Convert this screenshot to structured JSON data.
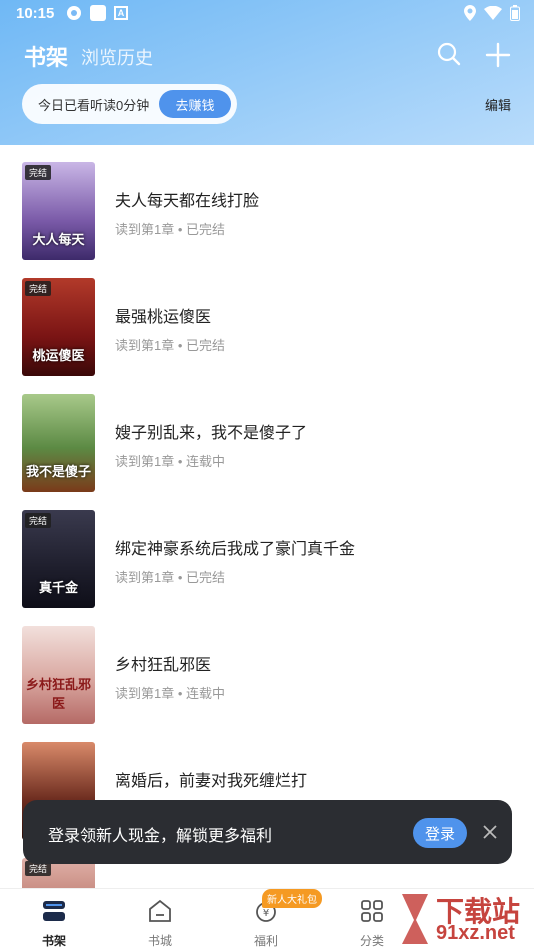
{
  "status_bar": {
    "time": "10:15"
  },
  "header": {
    "tab_active": "书架",
    "tab_inactive": "浏览历史",
    "reading_text": "今日已看听读0分钟",
    "earn_label": "去赚钱",
    "edit_label": "编辑"
  },
  "books": [
    {
      "title": "夫人每天都在线打脸",
      "status": "读到第1章 • 已完结",
      "badge": "完结",
      "cover_text": "大人每天",
      "cover_color": "#8a6fb5"
    },
    {
      "title": "最强桃运傻医",
      "status": "读到第1章 • 已完结",
      "badge": "完结",
      "cover_text": "桃运傻医",
      "cover_color": "#8b1a1a"
    },
    {
      "title": "嫂子别乱来，我不是傻子了",
      "status": "读到第1章 • 连载中",
      "badge": "",
      "cover_text": "我不是傻子",
      "cover_color": "#4a7a3a"
    },
    {
      "title": "绑定神豪系统后我成了豪门真千金",
      "status": "读到第1章 • 已完结",
      "badge": "完结",
      "cover_text": "真千金",
      "cover_color": "#2a2a3a"
    },
    {
      "title": "乡村狂乱邪医",
      "status": "读到第1章 • 连载中",
      "badge": "",
      "cover_text": "乡村狂乱邪医",
      "cover_color": "#d9a7a0"
    },
    {
      "title": "离婚后，前妻对我死缠烂打",
      "status": "",
      "badge": "",
      "cover_text": "",
      "cover_color": "#6b2b1e"
    }
  ],
  "toast": {
    "text": "登录领新人现金，解锁更多福利",
    "login_label": "登录"
  },
  "bottom_nav": {
    "items": [
      {
        "label": "书架"
      },
      {
        "label": "书城"
      },
      {
        "label": "福利"
      },
      {
        "label": "分类"
      }
    ],
    "gift_badge": "新人大礼包"
  },
  "watermark": {
    "line1": "下载站",
    "line2": "91xz.net"
  },
  "colors": {
    "accent": "#4f93ec",
    "header_start": "#6fb8f5",
    "toast_bg": "#2b2d32",
    "badge": "#f59a23"
  }
}
